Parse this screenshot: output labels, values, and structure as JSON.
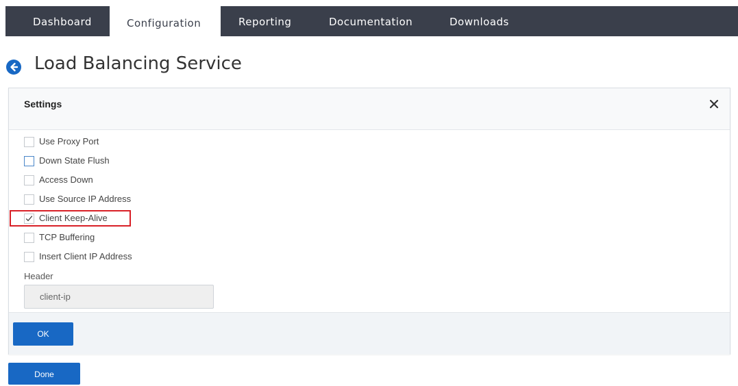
{
  "nav": {
    "tabs": [
      {
        "label": "Dashboard",
        "active": false
      },
      {
        "label": "Configuration",
        "active": true
      },
      {
        "label": "Reporting",
        "active": false
      },
      {
        "label": "Documentation",
        "active": false
      },
      {
        "label": "Downloads",
        "active": false
      }
    ]
  },
  "page": {
    "title": "Load Balancing Service",
    "back_icon": "arrow-left-circle-icon"
  },
  "settings": {
    "title": "Settings",
    "close_icon": "close-icon",
    "options": [
      {
        "label": "Use Proxy Port",
        "checked": false
      },
      {
        "label": "Down State Flush",
        "checked": false
      },
      {
        "label": "Access Down",
        "checked": false
      },
      {
        "label": "Use Source IP Address",
        "checked": false
      },
      {
        "label": "Client Keep-Alive",
        "checked": true,
        "highlighted": true
      },
      {
        "label": "TCP Buffering",
        "checked": false
      },
      {
        "label": "Insert Client IP Address",
        "checked": false
      }
    ],
    "header_label": "Header",
    "header_value": "client-ip",
    "ok_label": "OK"
  },
  "done_label": "Done",
  "colors": {
    "nav_bg": "#3a3f4b",
    "primary": "#1868c4",
    "highlight": "#d81f26"
  }
}
